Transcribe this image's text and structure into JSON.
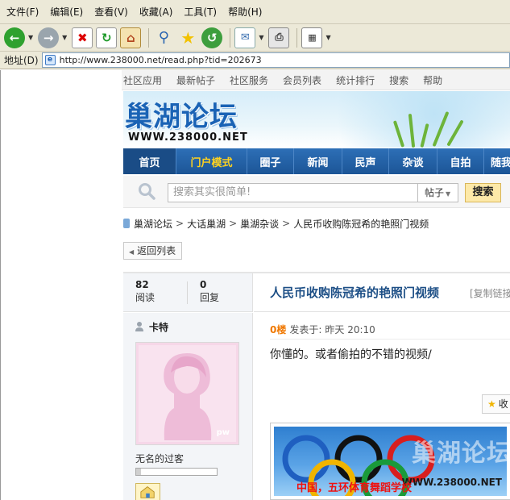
{
  "browser": {
    "menu": [
      "文件(F)",
      "编辑(E)",
      "查看(V)",
      "收藏(A)",
      "工具(T)",
      "帮助(H)"
    ],
    "toolbar_icons": [
      "back-icon",
      "forward-icon",
      "stop-icon",
      "refresh-icon",
      "home-icon",
      "search-icon",
      "favorites-icon",
      "history-icon",
      "mail-icon",
      "print-icon",
      "edit-icon"
    ],
    "address_label": "地址(D)",
    "url": "http://www.238000.net/read.php?tid=202673"
  },
  "site": {
    "top_nav": [
      "社区应用",
      "最新帖子",
      "社区服务",
      "会员列表",
      "统计排行",
      "搜索",
      "帮助"
    ],
    "logo_text": "巢湖论坛",
    "logo_url": "WWW.238000.NET",
    "main_nav": [
      "首页",
      "门户模式",
      "圈子",
      "新闻",
      "民声",
      "杂谈",
      "自拍",
      "随我"
    ],
    "search": {
      "placeholder": "搜索其实很简单!",
      "type": "帖子",
      "button": "搜索"
    },
    "breadcrumb": [
      "巢湖论坛",
      "大话巢湖",
      "巢湖杂谈",
      "人民币收购陈冠希的艳照门视频"
    ],
    "back_button": "返回列表"
  },
  "thread": {
    "views": "82",
    "views_label": "阅读",
    "replies": "0",
    "replies_label": "回复",
    "title": "人民币收购陈冠希的艳照门视频",
    "copy_link": "[复制链接"
  },
  "post": {
    "author": "卡特",
    "avatar_mark": "pw",
    "rank": "无名的过客",
    "rank_progress": 0.06,
    "floor": "0楼",
    "posted_label": "发表于:",
    "posted_time": "昨天  20:10",
    "content": "你懂的。或者偷拍的不错的视频/",
    "favorite": "收",
    "image_caption": "中国，五环体育舞蹈学校",
    "watermark_cn": "巢湖论坛",
    "watermark_url": "WWW.238000.NET"
  },
  "colors": {
    "nav_blue": "#1c5596",
    "title_blue": "#1d4f86",
    "floor_orange": "#f07800",
    "portal_yellow": "#ffd21f"
  }
}
